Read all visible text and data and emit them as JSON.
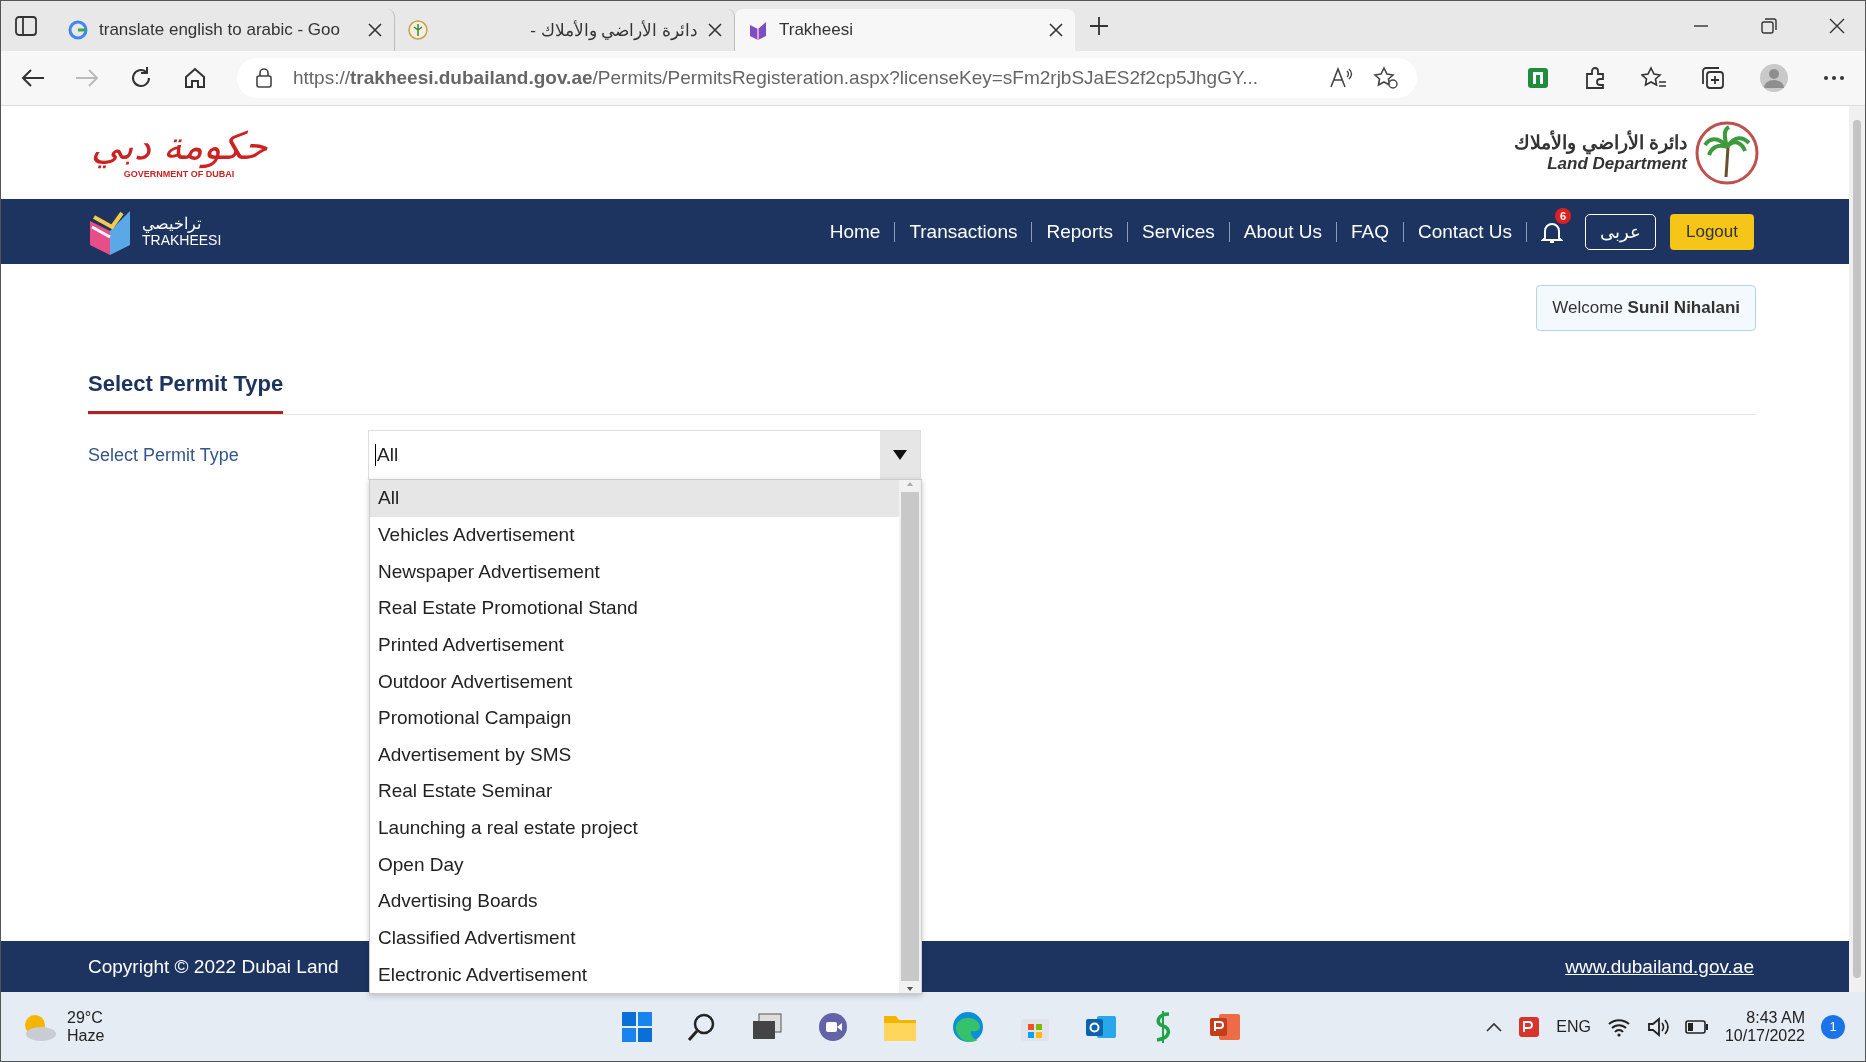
{
  "browser": {
    "tabs": [
      {
        "title": "translate english to arabic - Goo",
        "kind": "google",
        "selected": false
      },
      {
        "title": "دائرة الأراضي والأملاك -",
        "kind": "emblem",
        "selected": false
      },
      {
        "title": "Trakheesi",
        "kind": "trakheesi",
        "selected": true
      }
    ],
    "url": "https://**trakheesi.dubailand.gov.ae**/Permits/PermitsRegisteration.aspx?licenseKey=sFm2rjbSJaES2f2cp5JhgGY..."
  },
  "header": {
    "gov_logo": {
      "arabic": "حكومة دبي",
      "english": "GOVERNMENT OF DUBAI"
    },
    "dept_logo": {
      "arabic": "دائرة الأراضي والأملاك",
      "english": "Land Department"
    }
  },
  "nav": {
    "brand": {
      "arabic": "تراخيصي",
      "english": "TRAKHEESI"
    },
    "items": [
      "Home",
      "Transactions",
      "Reports",
      "Services",
      "About Us",
      "FAQ",
      "Contact Us"
    ],
    "notifications": "6",
    "language": "عربى",
    "logout": "Logout"
  },
  "welcome": "Welcome **Sunil Nihalani**",
  "section_title": "Select Permit Type",
  "permit_field": {
    "label": "Select Permit Type",
    "value": "All",
    "options": [
      {
        "label": "All",
        "selected": true
      },
      {
        "label": "Vehicles Advertisement",
        "selected": false
      },
      {
        "label": "Newspaper Advertisement",
        "selected": false
      },
      {
        "label": "Real Estate Promotional Stand",
        "selected": false
      },
      {
        "label": "Printed Advertisement",
        "selected": false
      },
      {
        "label": "Outdoor Advertisement",
        "selected": false
      },
      {
        "label": "Promotional Campaign",
        "selected": false
      },
      {
        "label": "Advertisement by SMS",
        "selected": false
      },
      {
        "label": "Real Estate Seminar",
        "selected": false
      },
      {
        "label": "Launching a real estate project",
        "selected": false
      },
      {
        "label": "Open Day",
        "selected": false
      },
      {
        "label": "Advertising Boards",
        "selected": false
      },
      {
        "label": "Classified Advertisment",
        "selected": false
      },
      {
        "label": "Electronic Advertisement",
        "selected": false
      }
    ]
  },
  "footer": {
    "copyright": "Copyright © 2022 Dubai Land",
    "link": "www.dubailand.gov.ae"
  },
  "taskbar": {
    "temperature": "29°C",
    "weather": "Haze",
    "language": "ENG",
    "time": "8:43 AM",
    "date": "10/17/2022",
    "notifications": "1"
  }
}
